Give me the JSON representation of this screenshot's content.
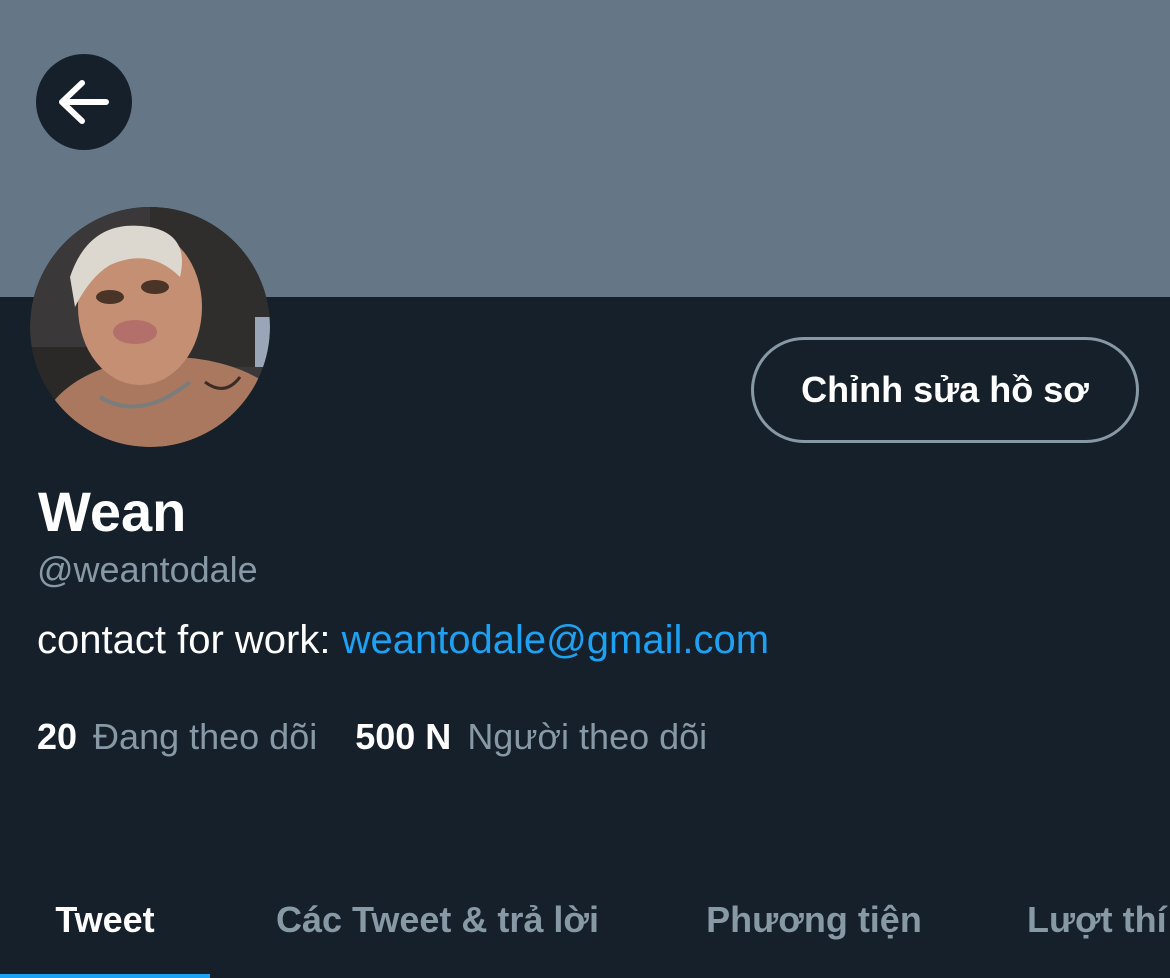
{
  "header": {
    "back_icon": "arrow-left-icon",
    "banner_color": "#657786"
  },
  "profile": {
    "display_name": "Wean",
    "handle": "@weantodale",
    "bio_prefix": "contact for work: ",
    "bio_link": "weantodale@gmail.com",
    "edit_button_label": "Chỉnh sửa hồ sơ",
    "avatar": "profile-photo"
  },
  "stats": {
    "following_count": "20",
    "following_label": "Đang theo dõi",
    "followers_count": "500 N",
    "followers_label": "Người theo dõi"
  },
  "tabs": [
    {
      "label": "Tweet",
      "active": true
    },
    {
      "label": "Các Tweet & trả lời",
      "active": false
    },
    {
      "label": "Phương tiện",
      "active": false
    },
    {
      "label": "Lượt thí",
      "active": false
    }
  ],
  "colors": {
    "background": "#15202b",
    "accent": "#1da1f2",
    "secondary_text": "#8899a6"
  }
}
